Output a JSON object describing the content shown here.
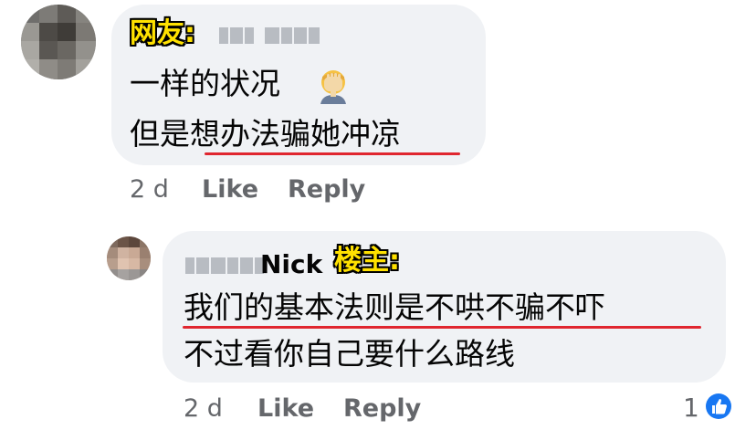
{
  "comment1": {
    "tag": "网友:",
    "lines": [
      "一样的状况",
      "但是想办法骗她冲凉"
    ],
    "time": "2 d",
    "like_label": "Like",
    "reply_label": "Reply",
    "emoji": "face-palm-icon"
  },
  "comment2": {
    "author_visible": "Nick",
    "tag": "楼主:",
    "lines": [
      "我们的基本法则是不哄不骗不吓",
      "不过看你自己要什么路线"
    ],
    "time": "2 d",
    "like_label": "Like",
    "reply_label": "Reply",
    "reaction_count": "1",
    "reaction_icon": "thumbs-up-icon"
  },
  "colors": {
    "bubble": "#f0f2f5",
    "meta_text": "#65676b",
    "tag_fill": "#ffe100",
    "underline": "#e0262f",
    "like_blue": "#1877f2"
  }
}
